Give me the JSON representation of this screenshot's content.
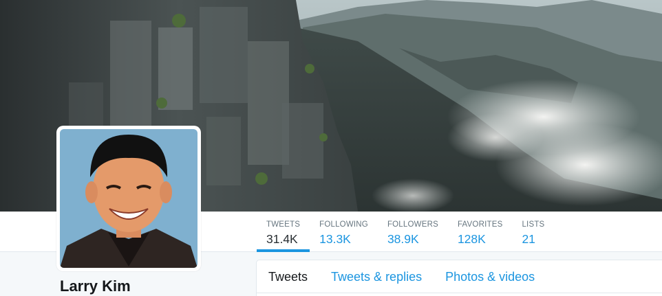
{
  "profile": {
    "name": "Larry Kim"
  },
  "stats": [
    {
      "label": "TWEETS",
      "value": "31.4K",
      "active": true
    },
    {
      "label": "FOLLOWING",
      "value": "13.3K",
      "active": false
    },
    {
      "label": "FOLLOWERS",
      "value": "38.9K",
      "active": false
    },
    {
      "label": "FAVORITES",
      "value": "128K",
      "active": false
    },
    {
      "label": "LISTS",
      "value": "21",
      "active": false
    }
  ],
  "timeline_tabs": [
    {
      "label": "Tweets",
      "active": true
    },
    {
      "label": "Tweets & replies",
      "active": false
    },
    {
      "label": "Photos & videos",
      "active": false
    }
  ],
  "colors": {
    "accent": "#1b95e0",
    "text_dark": "#14171a",
    "text_muted": "#66757f"
  },
  "icons": [
    "header-photo",
    "avatar-photo"
  ]
}
